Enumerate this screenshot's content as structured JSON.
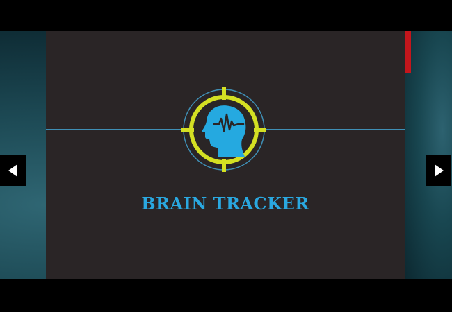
{
  "slide": {
    "title": "BRAIN TRACKER"
  },
  "icons": {
    "logo": "brain-tracker-head-crosshair-icon",
    "prev": "triangle-left-icon",
    "next": "triangle-right-icon"
  },
  "colors": {
    "slide_background": "#2a2526",
    "title_blue": "#2aa8e0",
    "reticle_yellow": "#d4e023",
    "reticle_blue": "#3f8fb5",
    "head_blue": "#25a9e0",
    "progress_red": "#c4161c",
    "letterbox": "#000000"
  }
}
